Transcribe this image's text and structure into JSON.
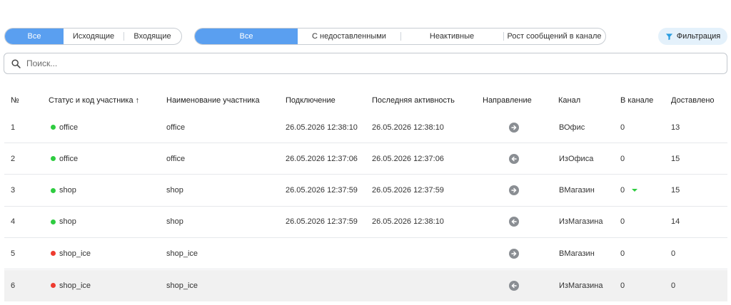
{
  "direction_tabs": [
    "Все",
    "Исходящие",
    "Входящие"
  ],
  "state_tabs": [
    "Все",
    "С недоставленными",
    "Неактивные",
    "Рост сообщений в канале"
  ],
  "filter": {
    "label": "Фильтрация",
    "icon": "funnel-icon"
  },
  "search": {
    "placeholder": "Поиск...",
    "value": "",
    "icon": "search-icon"
  },
  "columns": {
    "num": "№",
    "status": "Статус и код участника ↑",
    "name": "Наименование участника",
    "connected": "Подключение",
    "last": "Последняя активность",
    "direction": "Направление",
    "channel": "Канал",
    "in_channel": "В канале",
    "delivered": "Доставлено"
  },
  "colors": {
    "accent": "#5a9ff0",
    "online": "#2ecc40",
    "offline": "#ee3b2f",
    "arrow": "#8a8e93"
  },
  "rows": [
    {
      "num": "1",
      "status": "online",
      "code": "office",
      "name": "office",
      "connected": "26.05.2026 12:38:10",
      "last": "26.05.2026 12:38:10",
      "direction": "out",
      "channel": "ВОфис",
      "in_channel": "0",
      "delivered": "13",
      "trend": ""
    },
    {
      "num": "2",
      "status": "online",
      "code": "office",
      "name": "office",
      "connected": "26.05.2026 12:37:06",
      "last": "26.05.2026 12:37:06",
      "direction": "in",
      "channel": "ИзОфиса",
      "in_channel": "0",
      "delivered": "15",
      "trend": ""
    },
    {
      "num": "3",
      "status": "online",
      "code": "shop",
      "name": "shop",
      "connected": "26.05.2026 12:37:59",
      "last": "26.05.2026 12:37:59",
      "direction": "out",
      "channel": "ВМагазин",
      "in_channel": "0",
      "delivered": "15",
      "trend": "down"
    },
    {
      "num": "4",
      "status": "online",
      "code": "shop",
      "name": "shop",
      "connected": "26.05.2026 12:37:59",
      "last": "26.05.2026 12:38:10",
      "direction": "in",
      "channel": "ИзМагазина",
      "in_channel": "0",
      "delivered": "14",
      "trend": ""
    },
    {
      "num": "5",
      "status": "offline",
      "code": "shop_ice",
      "name": "shop_ice",
      "connected": "",
      "last": "",
      "direction": "out",
      "channel": "ВМагазин",
      "in_channel": "0",
      "delivered": "0",
      "trend": ""
    },
    {
      "num": "6",
      "status": "offline",
      "code": "shop_ice",
      "name": "shop_ice",
      "connected": "",
      "last": "",
      "direction": "in",
      "channel": "ИзМагазина",
      "in_channel": "0",
      "delivered": "0",
      "trend": "",
      "highlighted": true
    }
  ]
}
